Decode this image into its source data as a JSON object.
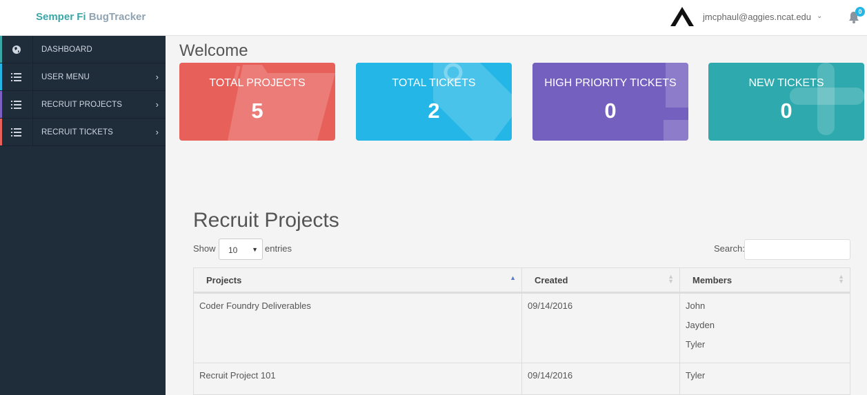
{
  "header": {
    "brand_part1": "Semper Fi",
    "brand_part2": "BugTracker",
    "user_email": "jmcphaul@aggies.ncat.edu",
    "notification_count": "0"
  },
  "sidebar": {
    "items": [
      {
        "label": "DASHBOARD",
        "icon": "globe-icon",
        "accent": "#3aa6a8"
      },
      {
        "label": "USER MENU",
        "icon": "list-icon",
        "accent": "#23b6e6"
      },
      {
        "label": "RECRUIT PROJECTS",
        "icon": "list-icon",
        "accent": "#7d60c2"
      },
      {
        "label": "RECRUIT TICKETS",
        "icon": "list-icon",
        "accent": "#e8605a"
      }
    ]
  },
  "main": {
    "welcome": "Welcome",
    "cards": [
      {
        "title": "TOTAL PROJECTS",
        "value": "5",
        "color": "#e8605a",
        "icon": "folder-icon"
      },
      {
        "title": "TOTAL TICKETS",
        "value": "2",
        "color": "#23b6e6",
        "icon": "tag-icon"
      },
      {
        "title": "HIGH PRIORITY TICKETS",
        "value": "0",
        "color": "#7460bf",
        "icon": "flag-icon"
      },
      {
        "title": "NEW TICKETS",
        "value": "0",
        "color": "#2ea9ad",
        "icon": "plus-icon"
      }
    ],
    "section_title": "Recruit Projects",
    "show_label": "Show",
    "entries_value": "10",
    "entries_label": "entries",
    "search_label": "Search:",
    "table": {
      "columns": [
        "Projects",
        "Created",
        "Members"
      ],
      "rows": [
        {
          "project": "Coder Foundry Deliverables",
          "created": "09/14/2016",
          "members": [
            "John",
            "Jayden",
            "Tyler"
          ]
        },
        {
          "project": "Recruit Project 101",
          "created": "09/14/2016",
          "members": [
            "Tyler"
          ]
        }
      ]
    }
  }
}
